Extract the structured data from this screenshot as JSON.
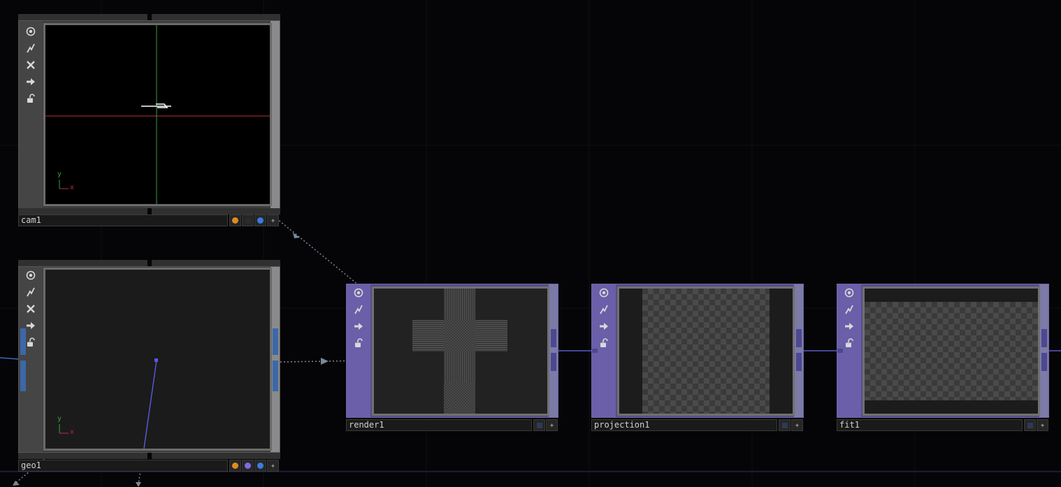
{
  "nodes": {
    "cam1": {
      "name": "cam1",
      "flags": [
        "orange",
        "dark",
        "blue",
        "plus"
      ],
      "axis_y": "y",
      "axis_x": "x"
    },
    "geo1": {
      "name": "geo1",
      "flags": [
        "orange",
        "purple",
        "blue",
        "plus"
      ],
      "axis_y": "y",
      "axis_x": "x"
    },
    "render1": {
      "name": "render1",
      "flags": [
        "dark",
        "plus"
      ]
    },
    "projection1": {
      "name": "projection1",
      "flags": [
        "dark",
        "plus"
      ]
    },
    "fit1": {
      "name": "fit1",
      "flags": [
        "dark",
        "plus"
      ]
    }
  },
  "sidebar_icons": [
    "viewer-toggle-icon",
    "bypass-icon",
    "close-icon",
    "arrow-right-icon",
    "lock-icon"
  ],
  "colors": {
    "background": "#050507",
    "wire_top": "#5a5ac8",
    "flag_orange": "#e08a1e",
    "flag_purple": "#7d6be0",
    "flag_blue": "#3a7be0",
    "axis_red": "#b03040",
    "axis_green": "#3aa040"
  }
}
